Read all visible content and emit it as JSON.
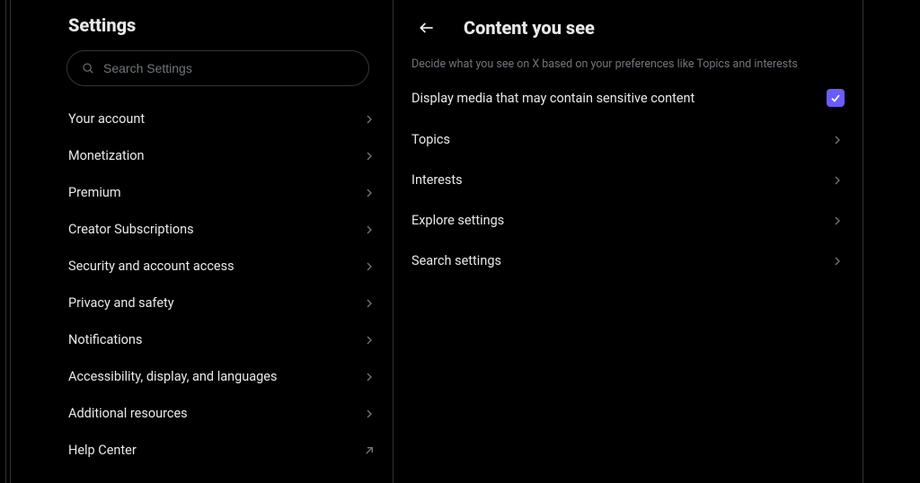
{
  "settings": {
    "title": "Settings",
    "search_placeholder": "Search Settings",
    "items": [
      {
        "label": "Your account"
      },
      {
        "label": "Monetization"
      },
      {
        "label": "Premium"
      },
      {
        "label": "Creator Subscriptions"
      },
      {
        "label": "Security and account access"
      },
      {
        "label": "Privacy and safety"
      },
      {
        "label": "Notifications"
      },
      {
        "label": "Accessibility, display, and languages"
      },
      {
        "label": "Additional resources"
      },
      {
        "label": "Help Center",
        "external": true
      }
    ]
  },
  "content": {
    "title": "Content you see",
    "description": "Decide what you see on X based on your preferences like Topics and interests",
    "toggle": {
      "label": "Display media that may contain sensitive content",
      "checked": true
    },
    "rows": [
      {
        "label": "Topics"
      },
      {
        "label": "Interests"
      },
      {
        "label": "Explore settings"
      },
      {
        "label": "Search settings"
      }
    ]
  },
  "colors": {
    "accent": "#6a5cff",
    "text_muted": "#71767b",
    "border": "#2f3336"
  }
}
